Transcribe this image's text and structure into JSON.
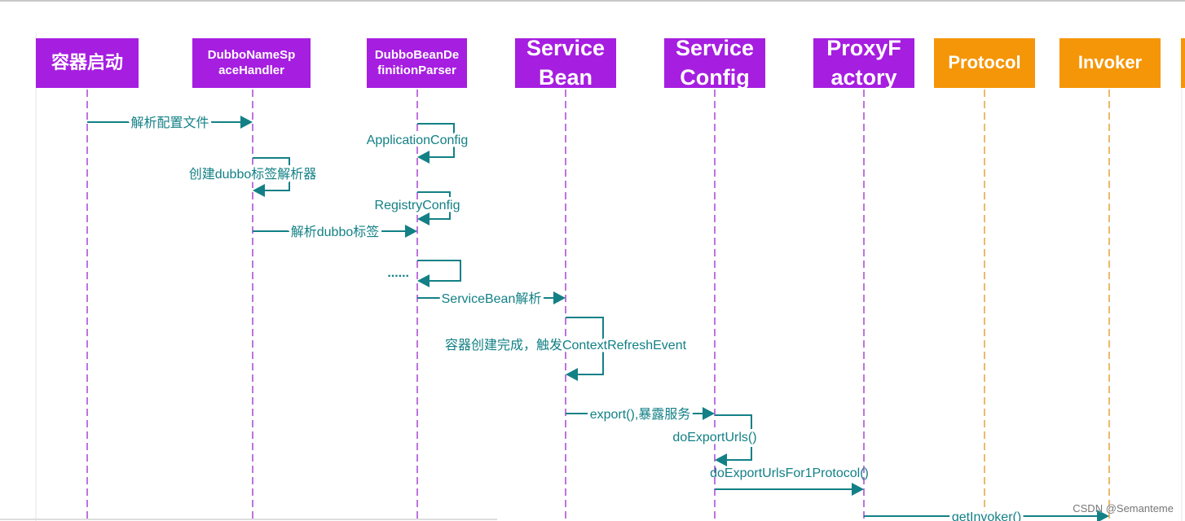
{
  "colors": {
    "participant_purple": "#a61ee0",
    "participant_orange": "#f59608",
    "lifeline_purple": "#a945d6",
    "lifeline_orange": "#e3a33a",
    "message": "#138086"
  },
  "participants": [
    {
      "lines": [
        "容器启动"
      ],
      "color": "purple"
    },
    {
      "lines": [
        "DubboNameSp",
        "aceHandler"
      ],
      "color": "purple"
    },
    {
      "lines": [
        "DubboBeanDe",
        "finitionParser"
      ],
      "color": "purple"
    },
    {
      "lines": [
        "Service",
        "Bean"
      ],
      "color": "purple"
    },
    {
      "lines": [
        "Service",
        "Config"
      ],
      "color": "purple"
    },
    {
      "lines": [
        "ProxyF",
        "actory"
      ],
      "color": "purple"
    },
    {
      "lines": [
        "Protocol"
      ],
      "color": "orange"
    },
    {
      "lines": [
        "Invoker"
      ],
      "color": "orange"
    }
  ],
  "messages": [
    {
      "from": 0,
      "to": 1,
      "label": "解析配置文件",
      "label_placement": "inline"
    },
    {
      "from": 2,
      "to": 2,
      "label": "ApplicationConfig",
      "label_placement": "center"
    },
    {
      "from": 1,
      "to": 1,
      "label": "创建dubbo标签解析器",
      "label_placement": "center"
    },
    {
      "from": 2,
      "to": 2,
      "label": "RegistryConfig",
      "label_placement": "center"
    },
    {
      "from": 1,
      "to": 2,
      "label": "解析dubbo标签",
      "label_placement": "inline"
    },
    {
      "from": 2,
      "to": 2,
      "label": "......",
      "label_placement": "left"
    },
    {
      "from": 2,
      "to": 3,
      "label": "ServiceBean解析",
      "label_placement": "inline"
    },
    {
      "from": 3,
      "to": 3,
      "label": "容器创建完成，触发ContextRefreshEvent",
      "label_placement": "center"
    },
    {
      "from": 3,
      "to": 4,
      "label": "export(),暴露服务",
      "label_placement": "inline"
    },
    {
      "from": 4,
      "to": 4,
      "label": "doExportUrls()",
      "label_placement": "center"
    },
    {
      "from": 4,
      "to": 5,
      "label": "doExportUrlsFor1Protocol()",
      "label_placement": "above"
    },
    {
      "from": 5,
      "to": 7,
      "label": "getInvoker()",
      "label_placement": "inline"
    }
  ],
  "watermark": "CSDN @Semanteme"
}
